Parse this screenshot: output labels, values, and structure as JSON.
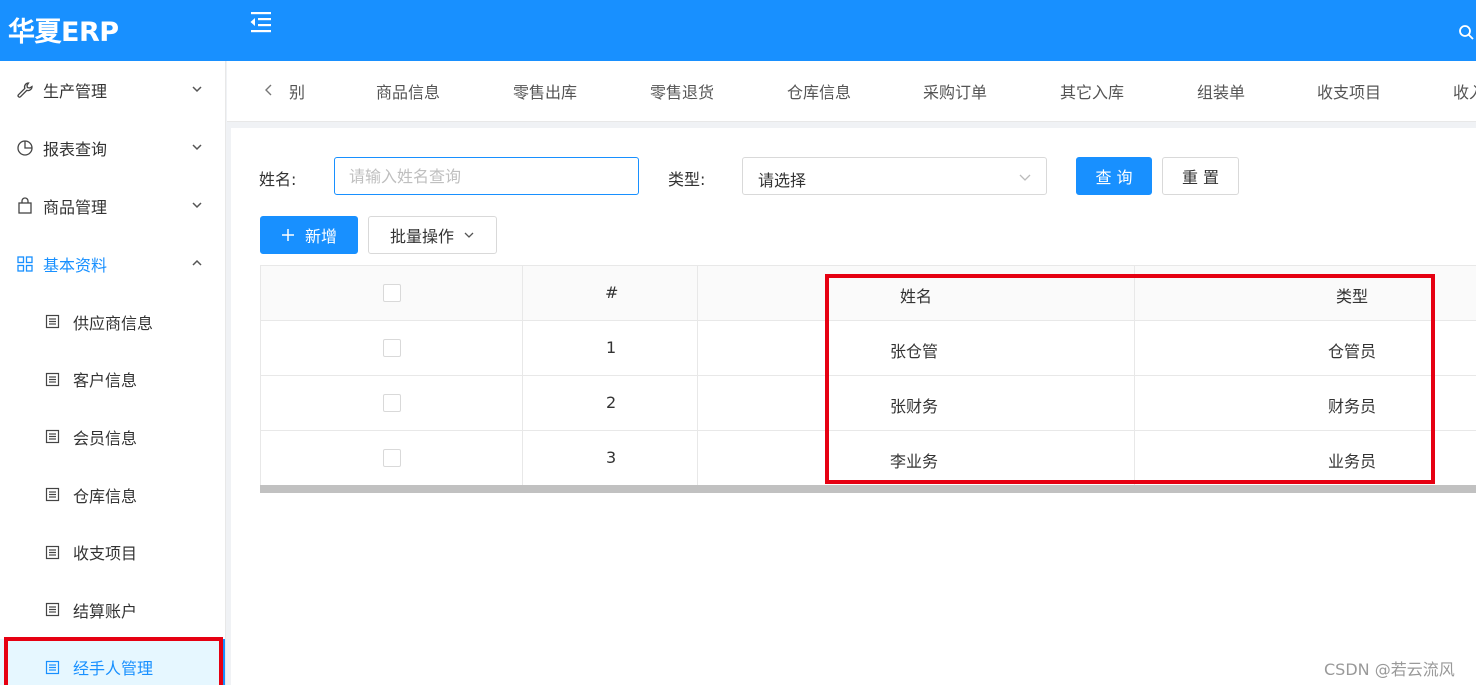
{
  "app": {
    "logo": "华夏ERP"
  },
  "sidebar": {
    "menus": [
      {
        "label": "生产管理",
        "icon": "wrench-icon",
        "state": "collapsed"
      },
      {
        "label": "报表查询",
        "icon": "pie-chart-icon",
        "state": "collapsed"
      },
      {
        "label": "商品管理",
        "icon": "shopping-bag-icon",
        "state": "collapsed"
      },
      {
        "label": "基本资料",
        "icon": "grid-icon",
        "state": "expanded"
      }
    ],
    "sub_items": [
      {
        "label": "供应商信息",
        "active": false
      },
      {
        "label": "客户信息",
        "active": false
      },
      {
        "label": "会员信息",
        "active": false
      },
      {
        "label": "仓库信息",
        "active": false
      },
      {
        "label": "收支项目",
        "active": false
      },
      {
        "label": "结算账户",
        "active": false
      },
      {
        "label": "经手人管理",
        "active": true
      }
    ]
  },
  "tabs": [
    "别",
    "商品信息",
    "零售出库",
    "零售退货",
    "仓库信息",
    "采购订单",
    "其它入库",
    "组装单",
    "收支项目",
    "收入"
  ],
  "filters": {
    "name_label": "姓名:",
    "name_placeholder": "请输入姓名查询",
    "type_label": "类型:",
    "type_value": "请选择",
    "query_button": "查 询",
    "reset_button": "重 置"
  },
  "toolbar": {
    "add_button": "新增",
    "batch_button": "批量操作"
  },
  "table": {
    "columns": [
      "#",
      "姓名",
      "类型"
    ],
    "rows": [
      {
        "index": "1",
        "name": "张仓管",
        "type": "仓管员"
      },
      {
        "index": "2",
        "name": "张财务",
        "type": "财务员"
      },
      {
        "index": "3",
        "name": "李业务",
        "type": "业务员"
      }
    ]
  },
  "watermark": "CSDN @若云流风",
  "colors": {
    "primary": "#1890ff",
    "highlight": "#e60012"
  }
}
